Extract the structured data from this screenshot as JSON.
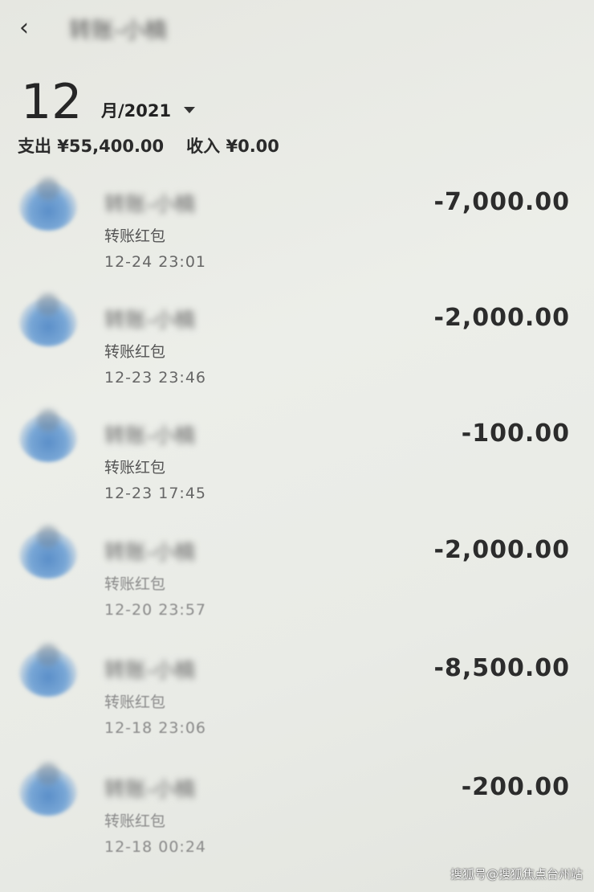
{
  "header": {
    "title": "转账-小楠"
  },
  "month_selector": {
    "month": "12",
    "suffix": "月/2021"
  },
  "summary": {
    "expense": "支出 ¥55,400.00",
    "income": "收入 ¥0.00"
  },
  "transactions": [
    {
      "name": "转账-小楠",
      "subtitle": "转账红包",
      "time": "12-24  23:01",
      "amount": "-7,000.00"
    },
    {
      "name": "转账-小楠",
      "subtitle": "转账红包",
      "time": "12-23  23:46",
      "amount": "-2,000.00"
    },
    {
      "name": "转账-小楠",
      "subtitle": "转账红包",
      "time": "12-23  17:45",
      "amount": "-100.00"
    },
    {
      "name": "转账-小楠",
      "subtitle": "转账红包",
      "time": "12-20  23:57",
      "amount": "-2,000.00"
    },
    {
      "name": "转账-小楠",
      "subtitle": "转账红包",
      "time": "12-18  23:06",
      "amount": "-8,500.00"
    },
    {
      "name": "转账-小楠",
      "subtitle": "转账红包",
      "time": "12-18  00:24",
      "amount": "-200.00"
    }
  ],
  "watermark": "搜狐号@搜狐焦点台州站"
}
